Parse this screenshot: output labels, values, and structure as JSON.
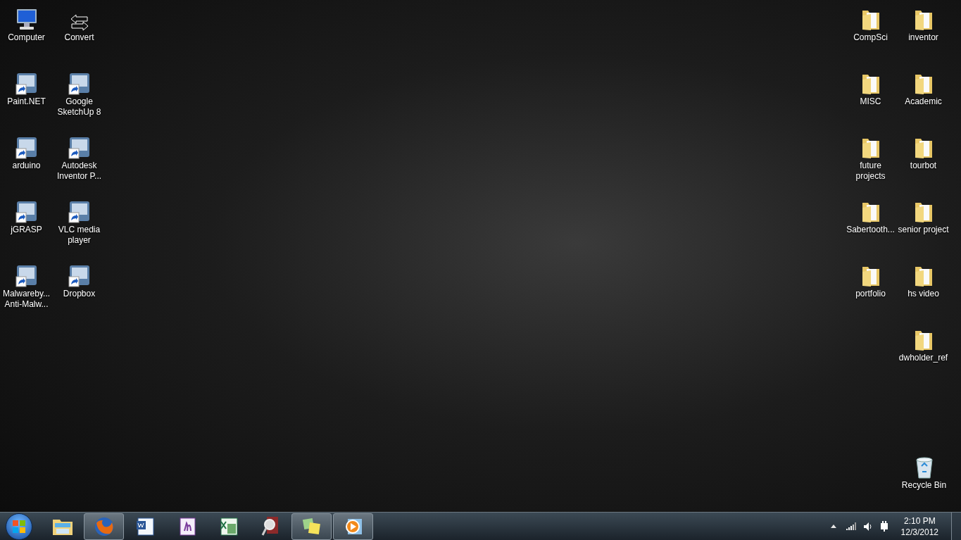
{
  "left_icons": [
    {
      "label": "Computer",
      "kind": "computer"
    },
    {
      "label": "Convert",
      "kind": "arrows"
    },
    {
      "label": "Paint.NET",
      "kind": "app"
    },
    {
      "label": "Google SketchUp 8",
      "kind": "app"
    },
    {
      "label": "arduino",
      "kind": "app"
    },
    {
      "label": "Autodesk Inventor P...",
      "kind": "app"
    },
    {
      "label": "jGRASP",
      "kind": "app"
    },
    {
      "label": "VLC media player",
      "kind": "app"
    },
    {
      "label": "Malwareby... Anti-Malw...",
      "kind": "app"
    },
    {
      "label": "Dropbox",
      "kind": "app"
    }
  ],
  "right_icons": [
    {
      "label": "CompSci",
      "kind": "folder"
    },
    {
      "label": "inventor",
      "kind": "folder"
    },
    {
      "label": "MISC",
      "kind": "folder"
    },
    {
      "label": "Academic",
      "kind": "folder"
    },
    {
      "label": "future projects",
      "kind": "folder"
    },
    {
      "label": "tourbot",
      "kind": "folder"
    },
    {
      "label": "Sabertooth...",
      "kind": "folder"
    },
    {
      "label": "senior project",
      "kind": "folder"
    },
    {
      "label": "portfolio",
      "kind": "folder"
    },
    {
      "label": "hs video",
      "kind": "folder"
    },
    {
      "label": "dwholder_ref",
      "kind": "folder"
    }
  ],
  "recycle_bin": {
    "label": "Recycle Bin"
  },
  "taskbar": {
    "buttons": [
      {
        "kind": "explorer",
        "running": false
      },
      {
        "kind": "firefox",
        "running": true
      },
      {
        "kind": "word",
        "running": false
      },
      {
        "kind": "onenote",
        "running": false
      },
      {
        "kind": "excel",
        "running": false
      },
      {
        "kind": "viewer",
        "running": false
      },
      {
        "kind": "notes",
        "running": true
      },
      {
        "kind": "player",
        "running": true
      }
    ],
    "clock": {
      "time": "2:10 PM",
      "date": "12/3/2012"
    }
  }
}
